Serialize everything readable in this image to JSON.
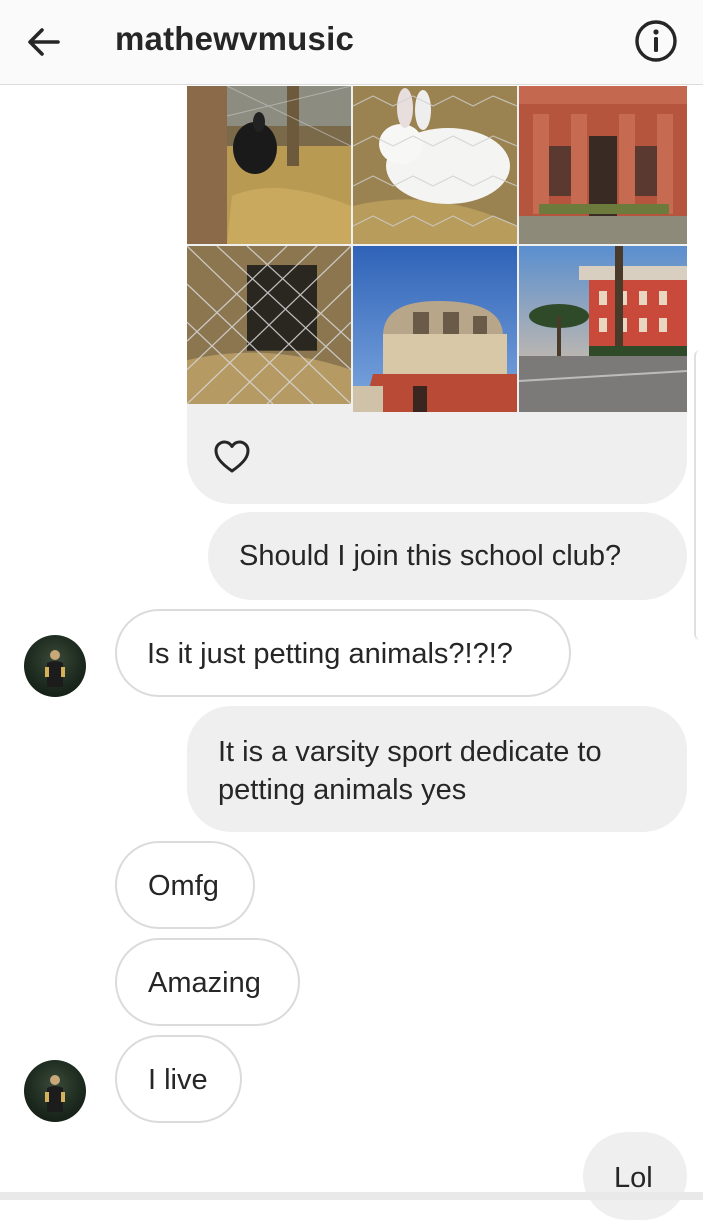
{
  "header": {
    "title": "mathewvmusic",
    "back_icon": "arrow-left-icon",
    "info_icon": "info-circle-icon"
  },
  "shared_post": {
    "like_icon": "heart-outline-icon",
    "photos": [
      {
        "subject": "black rabbit in straw pen"
      },
      {
        "subject": "white rabbit behind wire fence"
      },
      {
        "subject": "red brick building columns"
      },
      {
        "subject": "wire fence with straw"
      },
      {
        "subject": "domed brick building under blue sky"
      },
      {
        "subject": "red brick building with palm trees"
      }
    ]
  },
  "messages": [
    {
      "sender": "me",
      "text": "Should I join this school club?"
    },
    {
      "sender": "them",
      "text": "Is it just petting animals?!?!?"
    },
    {
      "sender": "me",
      "lines": [
        "It is a varsity sport dedicate to",
        "petting animals yes"
      ]
    },
    {
      "sender": "them",
      "text": "Omfg"
    },
    {
      "sender": "them",
      "text": "Amazing"
    },
    {
      "sender": "them",
      "text": "I live"
    },
    {
      "sender": "me",
      "text": "Lol"
    }
  ],
  "colors": {
    "header_bg": "#fafafa",
    "sent_bubble": "#efefef",
    "received_border": "#dbdbdb",
    "text": "#262626"
  }
}
